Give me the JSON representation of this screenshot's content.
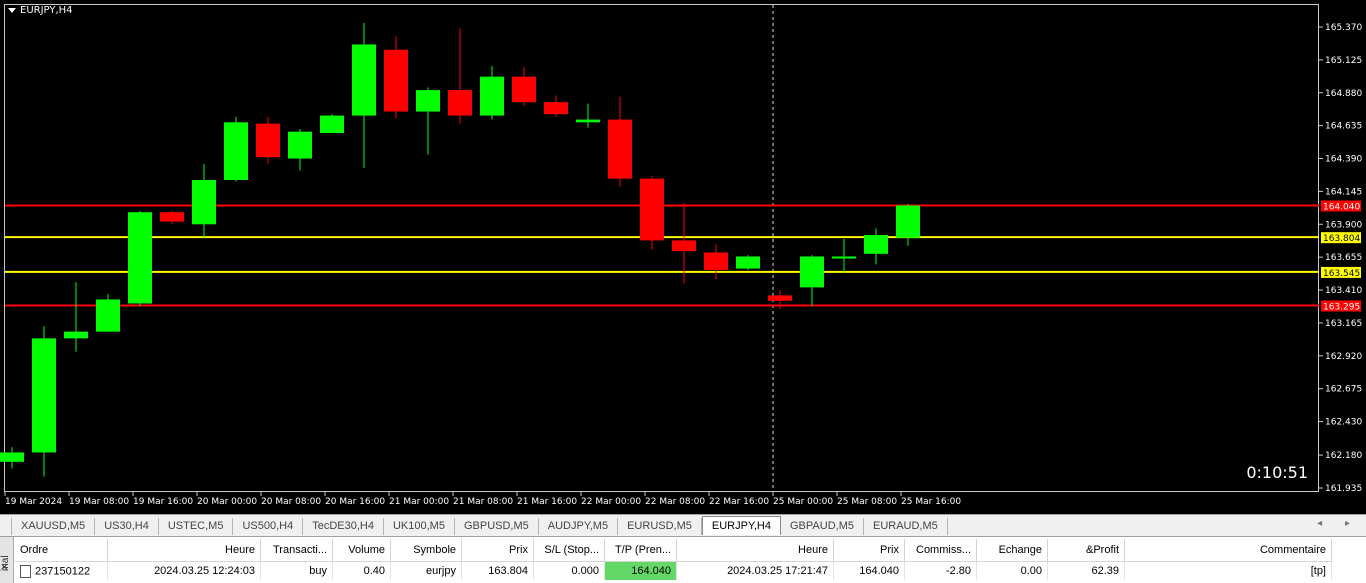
{
  "chart": {
    "title": "EURJPY,H4",
    "timer": "0:10:51",
    "colors": {
      "background": "#000000",
      "bull": "#00ff00",
      "bear": "#ff0000",
      "tp_line": "#ff0000",
      "entry_line": "#ffff00",
      "grid": "#c8c8c8"
    },
    "price_axis": [
      "165.370",
      "165.125",
      "164.880",
      "164.635",
      "164.390",
      "164.145",
      "163.900",
      "163.655",
      "163.410",
      "163.165",
      "162.920",
      "162.675",
      "162.430",
      "162.180",
      "161.935"
    ],
    "time_axis": [
      "19 Mar 2024",
      "19 Mar 08:00",
      "19 Mar 16:00",
      "20 Mar 00:00",
      "20 Mar 08:00",
      "20 Mar 16:00",
      "21 Mar 00:00",
      "21 Mar 08:00",
      "21 Mar 16:00",
      "22 Mar 00:00",
      "22 Mar 08:00",
      "22 Mar 16:00",
      "25 Mar 00:00",
      "25 Mar 08:00",
      "25 Mar 16:00"
    ],
    "levels": [
      {
        "price": 164.04,
        "label": "164.040",
        "color": "#ff0000",
        "text_color": "#ffffff"
      },
      {
        "price": 163.804,
        "label": "163.804",
        "color": "#ffff00",
        "text_color": "#000000"
      },
      {
        "price": 163.545,
        "label": "163.545",
        "color": "#ffff00",
        "text_color": "#000000"
      },
      {
        "price": 163.295,
        "label": "163.295",
        "color": "#ff0000",
        "text_color": "#ffffff"
      }
    ]
  },
  "chart_data": {
    "type": "candlestick",
    "symbol": "EURJPY",
    "timeframe": "H4",
    "ylim": [
      161.935,
      165.37
    ],
    "candles": [
      {
        "o": 162.13,
        "h": 162.24,
        "l": 162.08,
        "c": 162.2
      },
      {
        "o": 162.2,
        "h": 163.14,
        "l": 162.02,
        "c": 163.05
      },
      {
        "o": 163.05,
        "h": 163.47,
        "l": 162.95,
        "c": 163.1
      },
      {
        "o": 163.1,
        "h": 163.38,
        "l": 163.1,
        "c": 163.34
      },
      {
        "o": 163.31,
        "h": 164.0,
        "l": 163.29,
        "c": 163.99
      },
      {
        "o": 163.99,
        "h": 164.0,
        "l": 163.9,
        "c": 163.92
      },
      {
        "o": 163.9,
        "h": 164.35,
        "l": 163.8,
        "c": 164.23
      },
      {
        "o": 164.23,
        "h": 164.7,
        "l": 164.22,
        "c": 164.66
      },
      {
        "o": 164.65,
        "h": 164.7,
        "l": 164.35,
        "c": 164.4
      },
      {
        "o": 164.39,
        "h": 164.61,
        "l": 164.3,
        "c": 164.59
      },
      {
        "o": 164.58,
        "h": 164.72,
        "l": 164.58,
        "c": 164.71
      },
      {
        "o": 164.71,
        "h": 165.4,
        "l": 164.32,
        "c": 165.24
      },
      {
        "o": 165.2,
        "h": 165.3,
        "l": 164.69,
        "c": 164.74
      },
      {
        "o": 164.74,
        "h": 164.92,
        "l": 164.42,
        "c": 164.9
      },
      {
        "o": 164.9,
        "h": 165.36,
        "l": 164.65,
        "c": 164.71
      },
      {
        "o": 164.71,
        "h": 165.08,
        "l": 164.68,
        "c": 165.0
      },
      {
        "o": 165.0,
        "h": 165.07,
        "l": 164.78,
        "c": 164.81
      },
      {
        "o": 164.81,
        "h": 164.86,
        "l": 164.7,
        "c": 164.72
      },
      {
        "o": 164.66,
        "h": 164.8,
        "l": 164.62,
        "c": 164.68
      },
      {
        "o": 164.68,
        "h": 164.85,
        "l": 164.18,
        "c": 164.24
      },
      {
        "o": 164.24,
        "h": 164.26,
        "l": 163.71,
        "c": 163.78
      },
      {
        "o": 163.78,
        "h": 164.06,
        "l": 163.46,
        "c": 163.7
      },
      {
        "o": 163.69,
        "h": 163.75,
        "l": 163.49,
        "c": 163.56
      },
      {
        "o": 163.57,
        "h": 163.67,
        "l": 163.56,
        "c": 163.66
      },
      {
        "o": 163.37,
        "h": 163.41,
        "l": 163.27,
        "c": 163.33
      },
      {
        "o": 163.43,
        "h": 163.67,
        "l": 163.29,
        "c": 163.66
      },
      {
        "o": 163.65,
        "h": 163.79,
        "l": 163.54,
        "c": 163.66
      },
      {
        "o": 163.68,
        "h": 163.87,
        "l": 163.6,
        "c": 163.82
      },
      {
        "o": 163.8,
        "h": 164.05,
        "l": 163.74,
        "c": 164.04
      }
    ]
  },
  "symbol_tabs": [
    "XAUUSD,M5",
    "US30,H4",
    "USTEC,M5",
    "US500,H4",
    "TecDE30,H4",
    "UK100,M5",
    "GBPUSD,M5",
    "AUDJPY,M5",
    "EURUSD,M5",
    "EURJPY,H4",
    "GBPAUD,M5",
    "EURAUD,M5"
  ],
  "active_tab": "EURJPY,H4",
  "tab_arrows": "◂ ▸",
  "terminal": {
    "side_label": "inal",
    "columns": [
      "Ordre",
      "Heure",
      "Transacti...",
      "Volume",
      "Symbole",
      "Prix",
      "S/L (Stop...",
      "T/P (Pren...",
      "Heure",
      "Prix",
      "Commiss...",
      "Echange",
      "&Profit",
      "Commentaire"
    ],
    "row": [
      "237150122",
      "2024.03.25 12:24:03",
      "buy",
      "0.40",
      "eurjpy",
      "163.804",
      "0.000",
      "164.040",
      "2024.03.25 17:21:47",
      "164.040",
      "-2.80",
      "0.00",
      "62.39",
      "[tp]"
    ]
  }
}
